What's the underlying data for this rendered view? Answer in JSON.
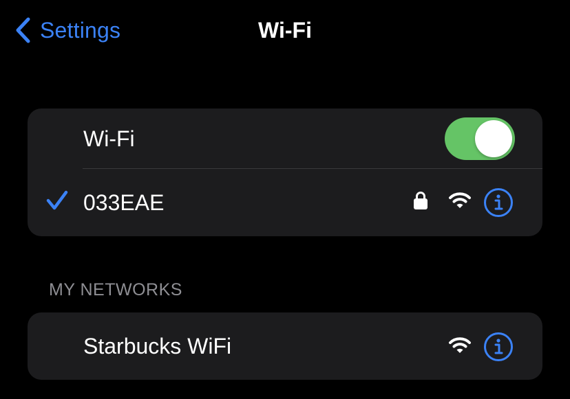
{
  "nav": {
    "back_label": "Settings",
    "title": "Wi-Fi"
  },
  "wifi_toggle": {
    "label": "Wi-Fi",
    "on": true
  },
  "current_network": {
    "name": "033EAE",
    "connected": true,
    "secured": true,
    "icons": [
      "checkmark-icon",
      "lock-icon",
      "wifi-signal-icon",
      "info-icon"
    ]
  },
  "my_networks": {
    "header": "MY NETWORKS",
    "items": [
      {
        "name": "Starbucks WiFi",
        "secured": false,
        "icons": [
          "wifi-signal-icon",
          "info-icon"
        ]
      }
    ]
  },
  "colors": {
    "background": "#000000",
    "card": "#1c1c1e",
    "accent": "#3b82f6",
    "toggle_on": "#65c466",
    "secondary_text": "#8e8e93",
    "separator": "#3a3a3c"
  }
}
